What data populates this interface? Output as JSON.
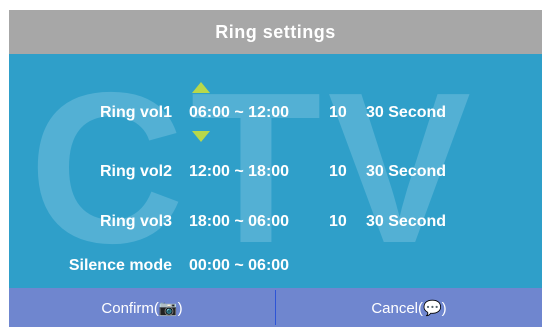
{
  "title": "Ring settings",
  "watermark": "CTV",
  "rows": [
    {
      "label": "Ring vol1",
      "time": "06:00 ~ 12:00",
      "volume": "10",
      "duration": "30 Second"
    },
    {
      "label": "Ring vol2",
      "time": "12:00 ~ 18:00",
      "volume": "10",
      "duration": "30 Second"
    },
    {
      "label": "Ring vol3",
      "time": "18:00 ~ 06:00",
      "volume": "10",
      "duration": "30 Second"
    },
    {
      "label": "Silence mode",
      "time": "00:00 ~ 06:00"
    }
  ],
  "buttons": {
    "confirm": "Confirm(📷)",
    "cancel": "Cancel(💬)"
  },
  "colors": {
    "title_bar": "#a7a7a7",
    "panel": "#2f9fc9",
    "footer": "#6f86cf",
    "arrow": "#b8d84a"
  }
}
